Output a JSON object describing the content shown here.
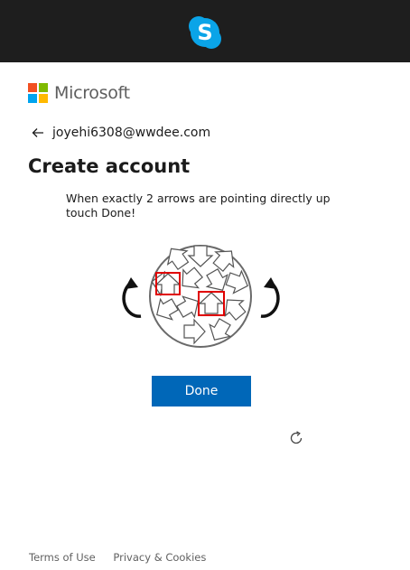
{
  "header": {
    "app_icon": "skype-icon",
    "brand_color": "#0aa4e8"
  },
  "brand": {
    "name": "Microsoft",
    "colors": [
      "#f25022",
      "#7fba00",
      "#00a4ef",
      "#ffb900"
    ]
  },
  "account": {
    "email": "joyehi6308@wwdee.com"
  },
  "page": {
    "title": "Create account"
  },
  "challenge": {
    "instruction": "When exactly 2 arrows are pointing directly up touch Done!",
    "rotate_left_icon": "rotate-left-icon",
    "rotate_right_icon": "rotate-right-icon"
  },
  "actions": {
    "done_label": "Done",
    "primary_color": "#0067b8"
  },
  "footer": {
    "terms": "Terms of Use",
    "privacy": "Privacy & Cookies"
  }
}
